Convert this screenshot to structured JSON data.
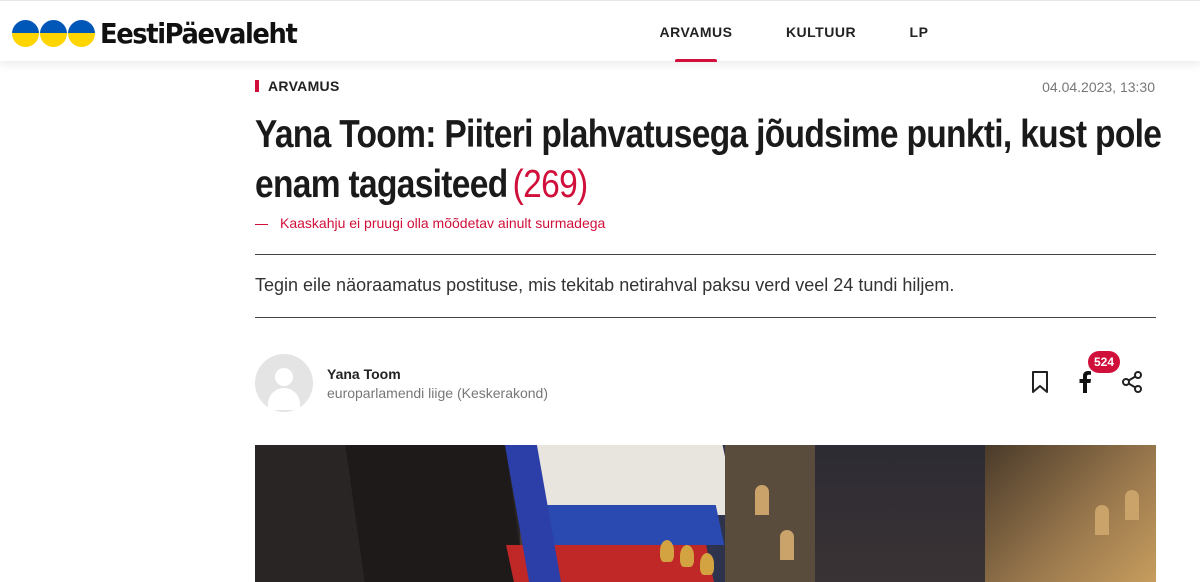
{
  "header": {
    "logo_text": "EestiPäevaleht",
    "flag_colors": {
      "top": "#0057b7",
      "bottom": "#ffd500"
    },
    "nav": [
      {
        "label": "ARVAMUS",
        "active": true
      },
      {
        "label": "KULTUUR",
        "active": false
      },
      {
        "label": "LP",
        "active": false
      }
    ]
  },
  "article": {
    "category": "ARVAMUS",
    "date": "04.04.2023, 13:30",
    "title": "Yana Toom: Piiteri plahvatusega jõudsime punkti, kust pole enam tagasiteed",
    "comment_count": "(269)",
    "subtitle": "Kaaskahju ei pruugi olla mõõdetav ainult surmadega",
    "lead": "Tegin eile näoraamatus postituse, mis tekitab netirahval paksu verd veel 24 tundi hiljem.",
    "author": {
      "name": "Yana Toom",
      "role": "europarlamendi liige (Keskerakond)"
    },
    "share": {
      "facebook_count": "524",
      "icons": [
        "bookmark-icon",
        "facebook-icon",
        "share-icon"
      ]
    }
  },
  "colors": {
    "accent": "#d0103a",
    "text": "#222222",
    "muted": "#777777"
  }
}
